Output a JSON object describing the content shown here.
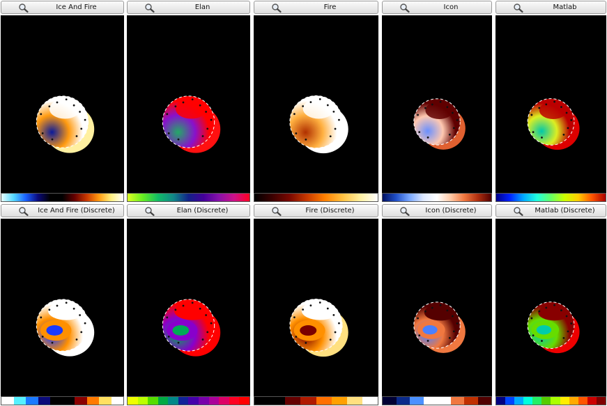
{
  "panels": [
    {
      "title": "Ice And Fire",
      "colormap": "ice-fire",
      "discrete": false,
      "stops": [
        "#e8ffff",
        "#55d8ff",
        "#1a60ff",
        "#0a0a7a",
        "#000000",
        "#000000",
        "#650000",
        "#c83800",
        "#ff9a10",
        "#fff080",
        "#ffffff"
      ],
      "head": {
        "high": "#ffffff",
        "mid": "#ff9a10",
        "low": "#0a1a9a",
        "edge": "#fff0a0"
      }
    },
    {
      "title": "Elan",
      "colormap": "elan",
      "discrete": false,
      "stops": [
        "#ddff22",
        "#66ee22",
        "#11bb66",
        "#118888",
        "#122288",
        "#440099",
        "#8811aa",
        "#cc1188",
        "#ff0022"
      ],
      "head": {
        "high": "#ff0000",
        "mid": "#8811cc",
        "low": "#22aa66",
        "edge": "#ff1010"
      }
    },
    {
      "title": "Fire",
      "colormap": "fire",
      "discrete": false,
      "stops": [
        "#000000",
        "#3a0000",
        "#7a0800",
        "#c83a00",
        "#ff8000",
        "#ffc040",
        "#fff0a0",
        "#ffffff"
      ],
      "head": {
        "high": "#ffffff",
        "mid": "#ffb040",
        "low": "#b03000",
        "edge": "#ffffff"
      }
    },
    {
      "title": "Icon",
      "colormap": "icon",
      "discrete": false,
      "stops": [
        "#001060",
        "#2050c8",
        "#7aa8ff",
        "#dde8ff",
        "#ffffff",
        "#ffcaa8",
        "#f07840",
        "#b03010",
        "#500000"
      ],
      "head": {
        "high": "#600000",
        "mid": "#ffc8b0",
        "low": "#6a90ff",
        "edge": "#e06030"
      }
    },
    {
      "title": "Matlab",
      "colormap": "jet",
      "discrete": false,
      "stops": [
        "#00008a",
        "#0022ff",
        "#00aaff",
        "#22ffdd",
        "#66ff66",
        "#ccff00",
        "#ffcc00",
        "#ff5500",
        "#aa0000"
      ],
      "head": {
        "high": "#bb0000",
        "mid": "#ddee22",
        "low": "#00c8aa",
        "edge": "#dd0000"
      }
    },
    {
      "title": "Ice And Fire (Discrete)",
      "colormap": "ice-fire",
      "discrete": true,
      "stops": [
        "#ffffff",
        "#55f0ff",
        "#1a7aff",
        "#0a0a7a",
        "#000000",
        "#000000",
        "#8a0000",
        "#ff7a00",
        "#ffe060",
        "#ffffff"
      ],
      "head": {
        "high": "#ffffff",
        "mid": "#ff9000",
        "low": "#1a3aff",
        "edge": "#ffffff"
      }
    },
    {
      "title": "Elan (Discrete)",
      "colormap": "elan",
      "discrete": true,
      "stops": [
        "#eeff00",
        "#bbff00",
        "#55dd00",
        "#00aa44",
        "#008888",
        "#112299",
        "#4400aa",
        "#7700aa",
        "#aa0099",
        "#dd0066",
        "#ff0022",
        "#ff0000"
      ],
      "head": {
        "high": "#ff0000",
        "mid": "#8800cc",
        "low": "#00aa55",
        "edge": "#ff0000"
      }
    },
    {
      "title": "Fire (Discrete)",
      "colormap": "fire",
      "discrete": true,
      "stops": [
        "#000000",
        "#000000",
        "#650000",
        "#b01a00",
        "#ff7000",
        "#ffa000",
        "#ffe080",
        "#ffffff"
      ],
      "head": {
        "high": "#ffffff",
        "mid": "#ff9000",
        "low": "#7a0000",
        "edge": "#ffe080"
      }
    },
    {
      "title": "Icon (Discrete)",
      "colormap": "icon",
      "discrete": true,
      "stops": [
        "#000033",
        "#0a2a8a",
        "#4a90ff",
        "#ffffff",
        "#ffffff",
        "#f07840",
        "#c03000",
        "#500000"
      ],
      "head": {
        "high": "#550000",
        "mid": "#f07840",
        "low": "#4a80ff",
        "edge": "#f07840"
      }
    },
    {
      "title": "Matlab (Discrete)",
      "colormap": "jet",
      "discrete": true,
      "stops": [
        "#000080",
        "#0044ff",
        "#00aaff",
        "#00ffdd",
        "#22ee66",
        "#55cc00",
        "#aaff00",
        "#ffee00",
        "#ffaa00",
        "#ff5500",
        "#cc0000",
        "#800000"
      ],
      "head": {
        "high": "#880000",
        "mid": "#66dd00",
        "low": "#00ccaa",
        "edge": "#ee0000"
      }
    }
  ]
}
